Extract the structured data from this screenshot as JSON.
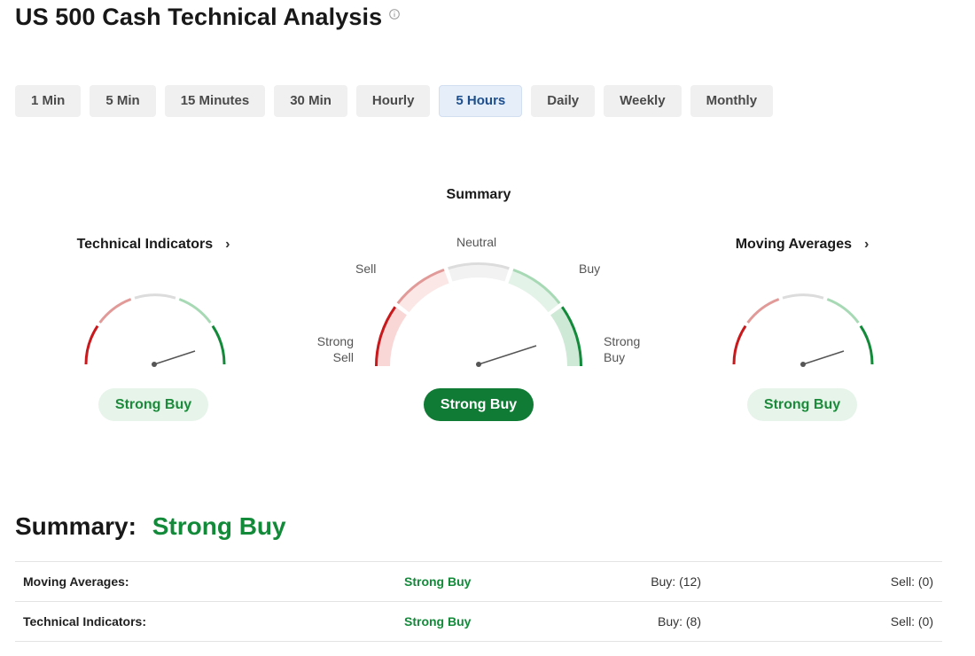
{
  "page": {
    "title": "US 500 Cash Technical Analysis"
  },
  "timeframes": [
    {
      "label": "1 Min",
      "active": false
    },
    {
      "label": "5 Min",
      "active": false
    },
    {
      "label": "15 Minutes",
      "active": false
    },
    {
      "label": "30 Min",
      "active": false
    },
    {
      "label": "Hourly",
      "active": false
    },
    {
      "label": "5 Hours",
      "active": true
    },
    {
      "label": "Daily",
      "active": false
    },
    {
      "label": "Weekly",
      "active": false
    },
    {
      "label": "Monthly",
      "active": false
    }
  ],
  "gauges": {
    "technical": {
      "heading": "Technical Indicators",
      "result": "Strong Buy"
    },
    "summary": {
      "heading": "Summary",
      "result": "Strong Buy",
      "labels": {
        "strong_sell_1": "Strong",
        "strong_sell_2": "Sell",
        "sell": "Sell",
        "neutral": "Neutral",
        "buy": "Buy",
        "strong_buy_1": "Strong",
        "strong_buy_2": "Buy"
      }
    },
    "moving": {
      "heading": "Moving Averages",
      "result": "Strong Buy"
    }
  },
  "summary": {
    "label": "Summary:",
    "value": "Strong Buy"
  },
  "table": [
    {
      "name": "Moving Averages:",
      "signal": "Strong Buy",
      "buy": "Buy: (12)",
      "sell": "Sell: (0)"
    },
    {
      "name": "Technical Indicators:",
      "signal": "Strong Buy",
      "buy": "Buy: (8)",
      "sell": "Sell: (0)"
    }
  ],
  "colors": {
    "strong_buy": "#138a3a",
    "strong_sell": "#c8191d",
    "active_tab": "#1e4e8c"
  }
}
